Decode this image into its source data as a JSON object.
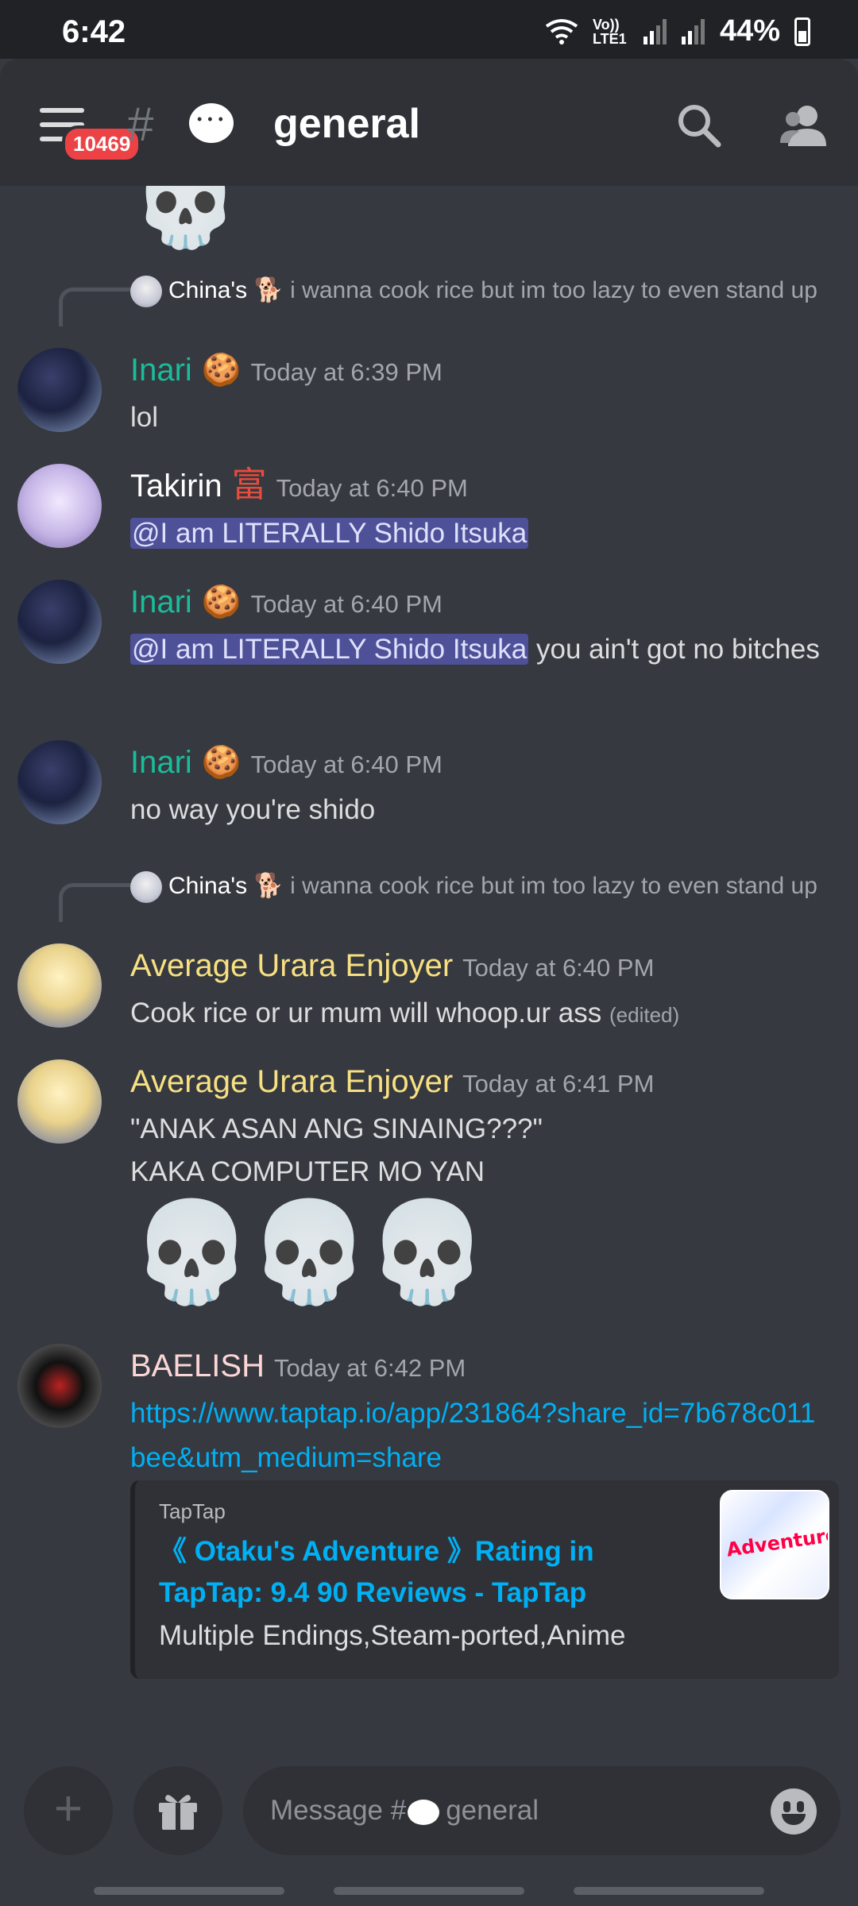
{
  "status_bar": {
    "time": "6:42",
    "network": "Vo)) LTE1",
    "battery": "44%"
  },
  "header": {
    "unread_badge": "10469",
    "hash": "#",
    "channel_name": "general"
  },
  "messages": [
    {
      "reply": {
        "author": "China's",
        "text": "i wanna cook rice but im too lazy to even stand up"
      },
      "author": "Inari",
      "author_color": "#1abc9c",
      "badge_emoji": "🍪",
      "time": "Today at 6:39 PM",
      "text": "lol"
    },
    {
      "author": "Takirin",
      "author_color": "#ffffff",
      "badge_emoji": "富",
      "time": "Today at 6:40 PM",
      "mention": "@I am LITERALLY Shido Itsuka"
    },
    {
      "author": "Inari",
      "author_color": "#1abc9c",
      "badge_emoji": "🍪",
      "time": "Today at 6:40 PM",
      "mention": "@I am LITERALLY Shido Itsuka",
      "text_after": " you ain't got no bitches"
    },
    {
      "author": "Inari",
      "author_color": "#1abc9c",
      "badge_emoji": "🍪",
      "time": "Today at 6:40 PM",
      "text": "no way you're shido"
    },
    {
      "reply": {
        "author": "China's",
        "text": "i wanna cook rice but im too lazy to even stand up"
      },
      "author": "Average Urara Enjoyer",
      "author_color": "#f7e082",
      "time": "Today at 6:40 PM",
      "text": "Cook rice or ur mum will whoop.ur ass",
      "edited": "(edited)"
    },
    {
      "author": "Average Urara Enjoyer",
      "author_color": "#f7e082",
      "time": "Today at 6:41 PM",
      "line1": "\"ANAK ASAN ANG SINAING???\"",
      "line2": "KAKA COMPUTER MO YAN",
      "skulls": "💀💀💀"
    },
    {
      "author": "BAELISH",
      "author_color": "#fcd6d6",
      "time": "Today at 6:42 PM",
      "link": "https://www.taptap.io/app/231864?share_id=7b678c011bee&utm_medium=share",
      "embed": {
        "provider": "TapTap",
        "title": "《 Otaku's Adventure 》Rating in TapTap: 9.4 90 Reviews - TapTap",
        "description": "Multiple Endings,Steam-ported,Anime",
        "thumb_text": "Adventure"
      }
    }
  ],
  "composer": {
    "placeholder_prefix": "Message #",
    "placeholder_channel": "general"
  }
}
